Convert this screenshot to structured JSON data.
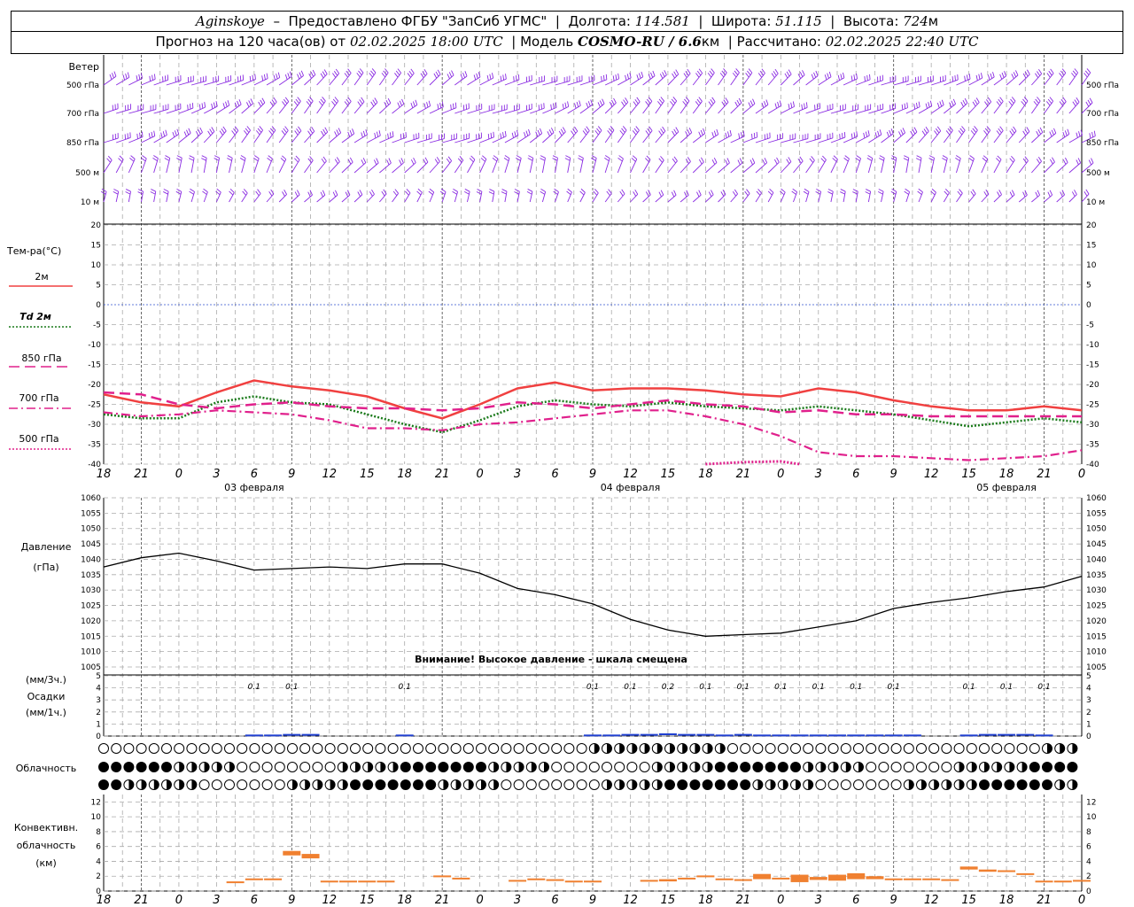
{
  "header": {
    "station": "Aginskoye",
    "provider": "Предоставлено ФГБУ \"ЗапСиб УГМС\"",
    "lon_label": "Долгота:",
    "lon": "114.581",
    "lat_label": "Широта:",
    "lat": "51.115",
    "alt_label": "Высота:",
    "alt": "724",
    "alt_unit": "м",
    "forecast_prefix": "Прогноз на 120 часа(ов) от",
    "forecast_time": "02.02.2025 18:00 UTC",
    "model_label": "Модель",
    "model": "COSMO-RU / 6.6",
    "model_unit": "км",
    "calc_label": "Рассчитано:",
    "calc_time": "02.02.2025 22:40 UTC"
  },
  "colors": {
    "t2m": "#f04040",
    "td2m": "#1a7a1a",
    "t850": "#e0208c",
    "t700": "#e0208c",
    "t500": "#e0208c",
    "wind": "#8a2be2",
    "precip": "#2040d0",
    "conv": "#f08030",
    "pressure": "#000000"
  },
  "wind": {
    "title": "Ветер",
    "levels": [
      "500 гПа",
      "700 гПа",
      "850 гПа",
      "500 м",
      "10   м"
    ]
  },
  "x_axis": {
    "hour_labels": [
      "18",
      "21",
      "0",
      "3",
      "6",
      "9",
      "12",
      "15",
      "18",
      "21",
      "0",
      "3",
      "6",
      "9",
      "12",
      "15",
      "18",
      "21",
      "0",
      "3",
      "6",
      "9",
      "12",
      "15",
      "18",
      "21",
      "0"
    ],
    "day_labels": [
      "03 февраля",
      "04 февраля",
      "05 февраля"
    ]
  },
  "temperature": {
    "title": "Тем-ра(°С)",
    "legend": [
      "2м",
      "Td 2м",
      "850 гПа",
      "700 гПа",
      "500 гПа"
    ],
    "ticks": [
      "20",
      "15",
      "10",
      "5",
      "0",
      "-5",
      "-10",
      "-15",
      "-20",
      "-25",
      "-30",
      "-35",
      "-40"
    ]
  },
  "pressure": {
    "title": "Давление",
    "unit": "(гПа)",
    "ticks": [
      "1060",
      "1055",
      "1050",
      "1045",
      "1040",
      "1035",
      "1030",
      "1025",
      "1020",
      "1015",
      "1010",
      "1005"
    ],
    "warning": "Внимание! Высокое давление - шкала смещена"
  },
  "precip": {
    "label1": "(мм/3ч.)",
    "label2": "Осадки",
    "label3": "(мм/1ч.)",
    "ticks": [
      "5",
      "4",
      "3",
      "2",
      "1",
      "0"
    ],
    "annotations": [
      {
        "hour": 24,
        "text": "0.1"
      },
      {
        "hour": 30,
        "text": "0.1"
      },
      {
        "hour": 48,
        "text": "0.1"
      },
      {
        "hour": 78,
        "text": "0.1"
      },
      {
        "hour": 84,
        "text": "0.1"
      },
      {
        "hour": 90,
        "text": "0.2"
      },
      {
        "hour": 96,
        "text": "0.1"
      },
      {
        "hour": 102,
        "text": "0.1"
      },
      {
        "hour": 108,
        "text": "0.1"
      },
      {
        "hour": 114,
        "text": "0.1"
      },
      {
        "hour": 120,
        "text": "0.1"
      },
      {
        "hour": 126,
        "text": "0.1"
      },
      {
        "hour": 138,
        "text": "0.1"
      },
      {
        "hour": 144,
        "text": "0.1"
      },
      {
        "hour": 150,
        "text": "0.1"
      }
    ]
  },
  "cloud": {
    "title": "Облачность"
  },
  "convective": {
    "label1": "Конвективн.",
    "label2": "облачность",
    "label3": "(км)",
    "ticks": [
      "12",
      "10",
      "8",
      "6",
      "4",
      "2",
      "0"
    ]
  },
  "chart_data": [
    {
      "type": "line",
      "title": "Тем-ра(°С)",
      "x_hours_from_start": [
        0,
        6,
        12,
        18,
        24,
        30,
        36,
        42,
        48,
        54,
        60,
        66,
        72,
        78,
        84,
        90,
        96,
        102,
        108,
        114,
        120,
        126,
        132,
        138,
        144,
        150,
        156
      ],
      "ylim": [
        -40,
        20
      ],
      "series": [
        {
          "name": "2м",
          "values": [
            -22.5,
            -24.5,
            -25.5,
            -22,
            -19,
            -20.5,
            -21.5,
            -23,
            -26,
            -28.5,
            -25,
            -21,
            -19.5,
            -21.5,
            -21,
            -21,
            -21.5,
            -22.5,
            -23,
            -21,
            -22,
            -24,
            -25.5,
            -26.5,
            -26.5,
            -25.5,
            -26.5
          ]
        },
        {
          "name": "Td 2м",
          "values": [
            -27.5,
            -28.5,
            -28.5,
            -24.5,
            -23,
            -24.5,
            -25,
            -27.5,
            -30,
            -32,
            -29,
            -25.5,
            -24,
            -25,
            -25.5,
            -24.5,
            -25.5,
            -26,
            -26.5,
            -25.5,
            -26.5,
            -27.5,
            -29,
            -30.5,
            -29.5,
            -28.5,
            -29.5
          ]
        },
        {
          "name": "850 гПа",
          "values": [
            -22,
            -22.5,
            -25,
            -26,
            -25,
            -24.5,
            -25.5,
            -26,
            -26,
            -26.5,
            -26,
            -24.5,
            -25,
            -26,
            -25,
            -24,
            -25,
            -25.5,
            -27,
            -26.5,
            -27.5,
            -27.5,
            -28,
            -28,
            -28,
            -28,
            -28
          ]
        },
        {
          "name": "700 гПа",
          "values": [
            -27,
            -28,
            -27.5,
            -26.5,
            -27,
            -27.5,
            -29,
            -31,
            -31,
            -31.5,
            -30,
            -29.5,
            -28.5,
            -27.5,
            -26.5,
            -26.5,
            -28,
            -30,
            -33,
            -37,
            -38,
            -38,
            -38.5,
            -39,
            -38.5,
            -38,
            -36.5
          ]
        },
        {
          "name": "500 гПа",
          "x_hours_from_start": [
            96,
            102,
            108,
            111
          ],
          "values": [
            -40,
            -39.5,
            -39.3,
            -40
          ]
        }
      ]
    },
    {
      "type": "line",
      "title": "Давление",
      "x_hours_from_start": [
        0,
        6,
        12,
        18,
        24,
        30,
        36,
        42,
        48,
        54,
        60,
        66,
        72,
        78,
        84,
        90,
        96,
        102,
        108,
        114,
        120,
        126,
        132,
        138,
        144,
        150,
        156
      ],
      "ylim": [
        1005,
        1060
      ],
      "series": [
        {
          "name": "",
          "values": [
            1037.5,
            1040.5,
            1042,
            1039.5,
            1036.5,
            1037,
            1037.5,
            1037,
            1038.5,
            1038.5,
            1035.5,
            1030.5,
            1028.5,
            1025.5,
            1020.5,
            1017,
            1015,
            1015.5,
            1016,
            1018,
            1020,
            1024,
            1026,
            1027.5,
            1029.5,
            1031,
            1034.5
          ]
        }
      ]
    },
    {
      "type": "bar",
      "title": "Осадки",
      "ylim": [
        0,
        5
      ],
      "x_hours_from_start": [
        24,
        27,
        30,
        33,
        48,
        78,
        81,
        84,
        87,
        90,
        93,
        96,
        99,
        102,
        105,
        108,
        111,
        114,
        117,
        120,
        123,
        126,
        129,
        138,
        141,
        144,
        147,
        150
      ],
      "values": [
        0.05,
        0.05,
        0.1,
        0.1,
        0.05,
        0.05,
        0.05,
        0.1,
        0.1,
        0.15,
        0.1,
        0.1,
        0.05,
        0.1,
        0.05,
        0.05,
        0.05,
        0.05,
        0.05,
        0.05,
        0.05,
        0.05,
        0.05,
        0.05,
        0.1,
        0.1,
        0.1,
        0.05
      ]
    },
    {
      "type": "bar",
      "title": "Конвективн. облачность",
      "ylim": [
        0,
        13
      ],
      "x_hours_from_start": [
        21,
        24,
        27,
        30,
        33,
        36,
        39,
        42,
        45,
        54,
        57,
        66,
        69,
        72,
        75,
        78,
        87,
        90,
        93,
        96,
        99,
        102,
        105,
        108,
        111,
        114,
        117,
        120,
        123,
        126,
        129,
        132,
        135,
        138,
        141,
        144,
        147,
        150,
        153,
        156
      ],
      "bottoms": [
        1.3,
        1.5,
        1.5,
        4.8,
        4.4,
        1.3,
        1.3,
        1.3,
        1.3,
        1.9,
        1.6,
        1.3,
        1.5,
        1.5,
        1.3,
        1.3,
        1.3,
        1.3,
        1.6,
        1.9,
        1.6,
        1.4,
        1.6,
        1.6,
        1.2,
        1.5,
        1.4,
        1.6,
        1.6,
        1.5,
        1.5,
        1.6,
        1.4,
        2.9,
        2.6,
        2.6,
        2.2,
        1.3,
        1.3,
        1.3
      ],
      "tops": [
        1.3,
        1.7,
        1.7,
        5.4,
        5.0,
        1.4,
        1.4,
        1.4,
        1.4,
        2.1,
        1.8,
        1.5,
        1.7,
        1.6,
        1.4,
        1.4,
        1.5,
        1.6,
        1.8,
        2.1,
        1.7,
        1.6,
        2.3,
        1.8,
        2.2,
        1.9,
        2.2,
        2.4,
        2.0,
        1.7,
        1.7,
        1.7,
        1.6,
        3.3,
        2.9,
        2.8,
        2.4,
        1.4,
        1.4,
        1.5
      ]
    }
  ]
}
